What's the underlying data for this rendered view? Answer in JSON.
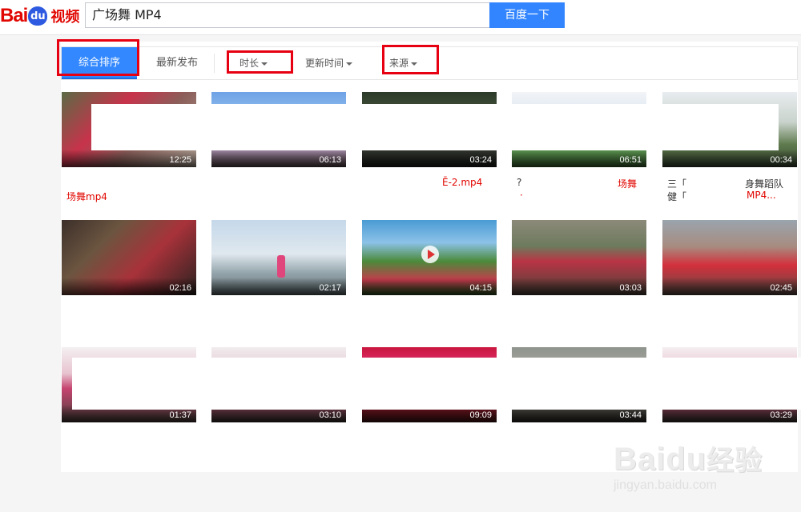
{
  "header": {
    "logo_text_1": "Bai",
    "logo_paw_text": "du",
    "logo_sub": "视频",
    "search_value": "广场舞 MP4",
    "search_button": "百度一下"
  },
  "tabs": {
    "comprehensive": "综合排序",
    "latest": "最新发布"
  },
  "filters": {
    "duration": "时长",
    "update_time": "更新时间",
    "source": "来源"
  },
  "videos": [
    {
      "duration": "12:25",
      "title_line1": "",
      "title_line2": "场舞mp4"
    },
    {
      "duration": "06:13",
      "title_line1": "",
      "title_line2": ""
    },
    {
      "duration": "03:24",
      "title_line1": "Ē-2.mp4",
      "title_line2": ""
    },
    {
      "duration": "06:51",
      "title_line1": "?",
      "title_line1b": "场舞",
      "title_line2": "·"
    },
    {
      "duration": "00:34",
      "title_line1": "三「",
      "title_line1b": "身舞蹈队",
      "title_line2": "健「",
      "title_line2b": "MP4..."
    },
    {
      "duration": "02:16"
    },
    {
      "duration": "02:17"
    },
    {
      "duration": "04:15"
    },
    {
      "duration": "03:03"
    },
    {
      "duration": "02:45"
    },
    {
      "duration": "01:37"
    },
    {
      "duration": "03:10"
    },
    {
      "duration": "09:09"
    },
    {
      "duration": "03:44"
    },
    {
      "duration": "03:29"
    }
  ],
  "watermark": {
    "main": "Bai",
    "paw": "du",
    "cn": "经验",
    "url": "jingyan.baidu.com"
  },
  "colors": {
    "brand_red": "#e10601",
    "brand_blue": "#3385ff",
    "highlight_red": "#e60012"
  }
}
